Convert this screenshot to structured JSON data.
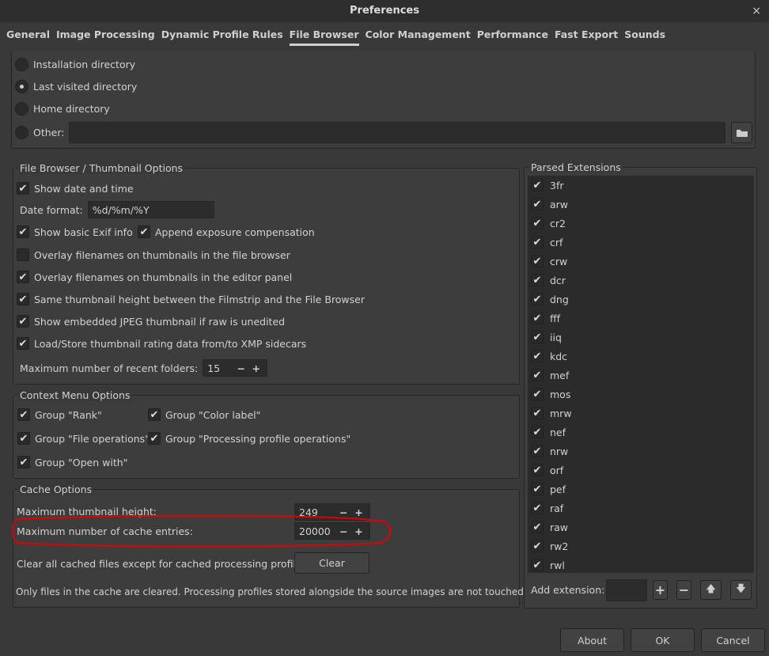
{
  "window": {
    "title": "Preferences",
    "close": "×"
  },
  "tabs": [
    {
      "label": "General"
    },
    {
      "label": "Image Processing"
    },
    {
      "label": "Dynamic Profile Rules"
    },
    {
      "label": "File Browser",
      "active": true
    },
    {
      "label": "Color Management"
    },
    {
      "label": "Performance"
    },
    {
      "label": "Fast Export"
    },
    {
      "label": "Sounds"
    }
  ],
  "startup": {
    "options": [
      {
        "label": "Installation directory",
        "selected": false
      },
      {
        "label": "Last visited directory",
        "selected": true
      },
      {
        "label": "Home directory",
        "selected": false
      }
    ],
    "other_label": "Other:",
    "other_value": ""
  },
  "thumb": {
    "title": "File Browser / Thumbnail Options",
    "show_date": "Show date and time",
    "date_format_label": "Date format:",
    "date_format": "%d/%m/%Y",
    "show_exif": "Show basic Exif info",
    "append_exp": "Append exposure compensation",
    "overlay_fb": "Overlay filenames on thumbnails in the file browser",
    "overlay_ed": "Overlay filenames on thumbnails in the editor panel",
    "same_height": "Same thumbnail height between the Filmstrip and the File Browser",
    "embedded": "Show embedded JPEG thumbnail if raw is unedited",
    "xmp": "Load/Store thumbnail rating data from/to XMP sidecars",
    "recent_label": "Maximum number of recent folders:",
    "recent_value": "15"
  },
  "context": {
    "title": "Context Menu Options",
    "rank": "Group \"Rank\"",
    "color": "Group \"Color label\"",
    "fileops": "Group \"File operations\"",
    "procops": "Group \"Processing profile operations\"",
    "openwith": "Group \"Open with\""
  },
  "cache": {
    "title": "Cache Options",
    "thumb_height_label": "Maximum thumbnail height:",
    "thumb_height": "249",
    "entries_label": "Maximum number of cache entries:",
    "entries": "20000",
    "clear_label": "Clear all cached files except for cached processing profiles:",
    "clear_button": "Clear",
    "note": "Only files in the cache are cleared. Processing profiles stored alongside the source images are not touched."
  },
  "extensions": {
    "title": "Parsed Extensions",
    "items": [
      "3fr",
      "arw",
      "cr2",
      "crf",
      "crw",
      "dcr",
      "dng",
      "fff",
      "iiq",
      "kdc",
      "mef",
      "mos",
      "mrw",
      "nef",
      "nrw",
      "orf",
      "pef",
      "raf",
      "raw",
      "rw2",
      "rwl"
    ],
    "add_label": "Add extension:",
    "add_value": ""
  },
  "footer": {
    "about": "About",
    "ok": "OK",
    "cancel": "Cancel"
  },
  "annotation_color": "#e00000"
}
